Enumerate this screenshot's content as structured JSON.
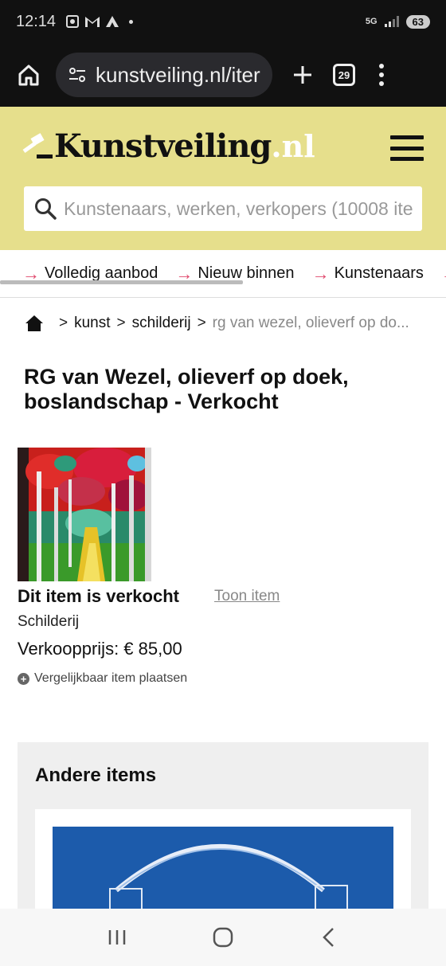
{
  "status_bar": {
    "time": "12:14",
    "network": "5G",
    "battery": "63"
  },
  "browser": {
    "url": "kunstveiling.nl/iter",
    "tab_count": "29"
  },
  "site": {
    "logo_name": "Kunstveiling",
    "logo_tld": ".nl",
    "search_placeholder": "Kunstenaars, werken, verkopers (10008 ite"
  },
  "category_nav": [
    {
      "label": "Volledig aanbod"
    },
    {
      "label": "Nieuw binnen"
    },
    {
      "label": "Kunstenaars"
    }
  ],
  "breadcrumb": {
    "items": [
      "kunst",
      "schilderij"
    ],
    "current": "rg van wezel, olieverf op do...",
    "separator": ">"
  },
  "item": {
    "title": "RG van Wezel, olieverf op doek, boslandschap - Verkocht",
    "sold_label": "Dit item is verkocht",
    "show_item": "Toon item",
    "category": "Schilderij",
    "price_label": "Verkoopprijs: € 85,00",
    "similar_label": "Vergelijkbaar item plaatsen"
  },
  "other_items": {
    "title": "Andere items"
  },
  "colors": {
    "header_bg": "#e6df8c",
    "accent_arrow": "#e0486c",
    "browser_bg": "#111111"
  }
}
